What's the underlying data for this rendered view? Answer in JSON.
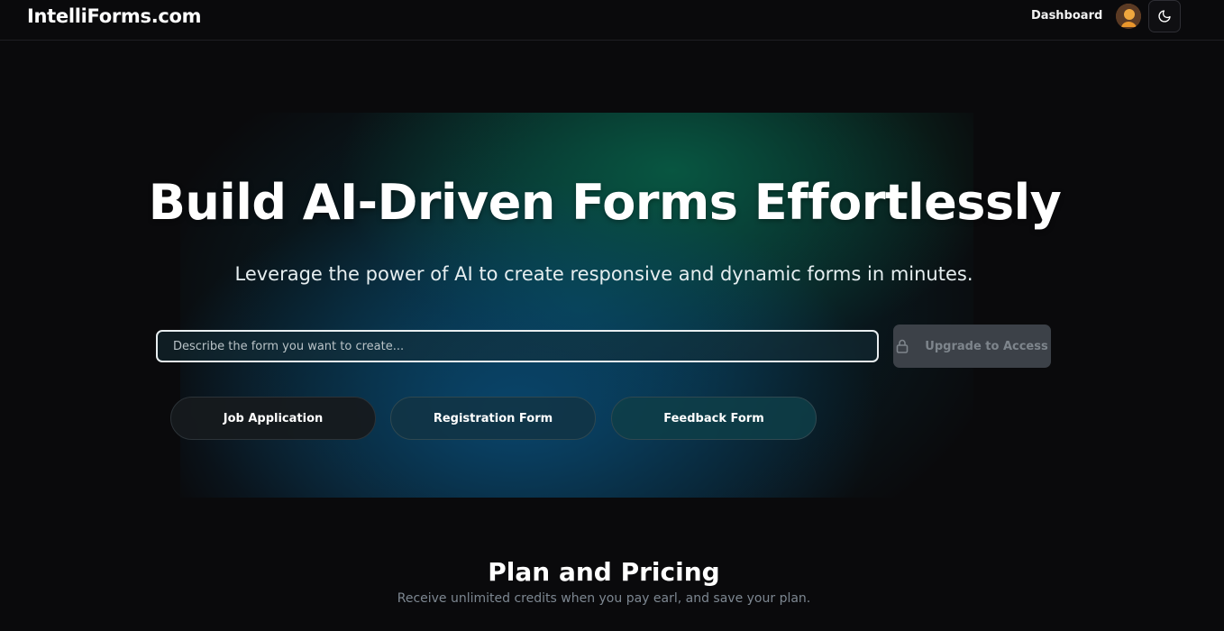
{
  "nav": {
    "brand": "IntelliForms.com",
    "dashboard_label": "Dashboard",
    "avatar": "user-avatar",
    "theme_icon": "moon-icon"
  },
  "hero": {
    "title": "Build AI-Driven Forms Effortlessly",
    "subtitle": "Leverage the power of AI to create responsive and dynamic forms in minutes.",
    "input": {
      "placeholder": "Describe the form you want to create...",
      "value": ""
    },
    "upgrade_button": {
      "label": "Upgrade to Access",
      "icon": "lock-icon",
      "disabled": true
    },
    "templates": [
      {
        "label": "Job Application"
      },
      {
        "label": "Registration Form"
      },
      {
        "label": "Feedback Form"
      }
    ]
  },
  "pricing": {
    "title": "Plan and Pricing",
    "subtitle": "Receive unlimited credits when you pay earl, and save your plan."
  },
  "colors": {
    "background": "#0a0a0c",
    "hero_teal": "#0b5a62",
    "hero_blue": "#09466e",
    "hero_green": "#085c44",
    "disabled_button": "#3c4148"
  }
}
